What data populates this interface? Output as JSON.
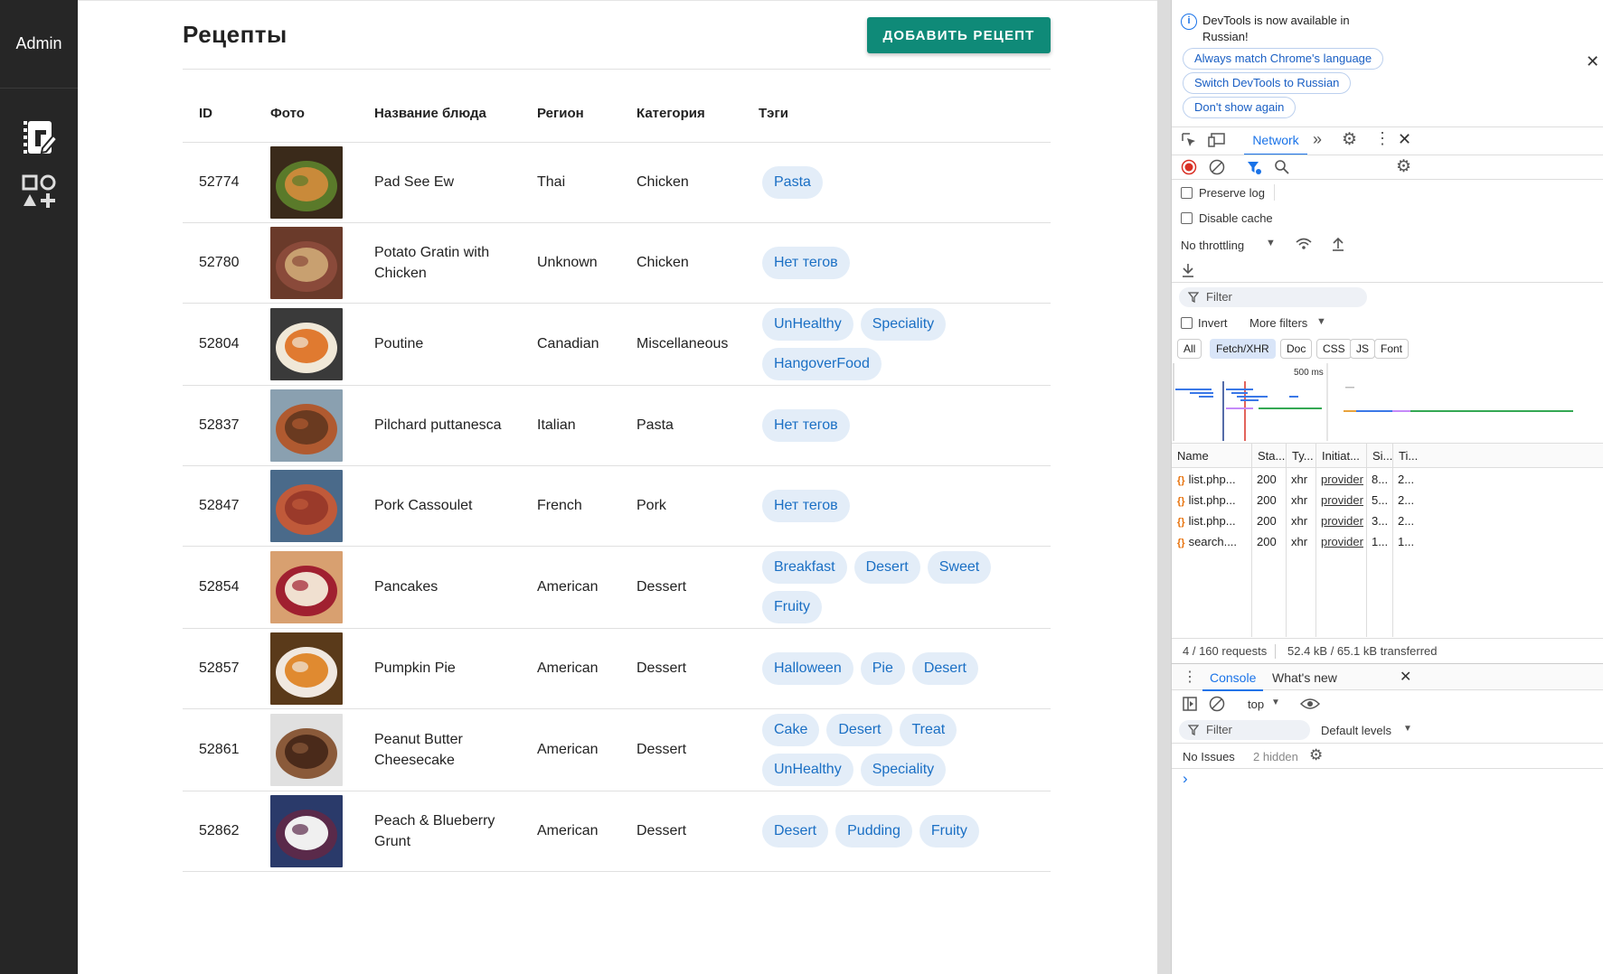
{
  "sidebar": {
    "title": "Admin",
    "items": [
      {
        "icon": "recipe-book-edit-icon"
      },
      {
        "icon": "shapes-add-icon"
      }
    ]
  },
  "header": {
    "title": "Рецепты",
    "add_button": "ДОБАВИТЬ РЕЦЕПТ"
  },
  "table": {
    "columns": [
      "ID",
      "Фото",
      "Название блюда",
      "Регион",
      "Категория",
      "Тэги"
    ],
    "rows": [
      {
        "id": "52774",
        "name": "Pad See Ew",
        "region": "Thai",
        "category": "Chicken",
        "tags": [
          "Pasta"
        ],
        "photo_colors": [
          "#3a2a1a",
          "#c98a3a",
          "#5a7a2a"
        ]
      },
      {
        "id": "52780",
        "name": "Potato Gratin with Chicken",
        "region": "Unknown",
        "category": "Chicken",
        "tags": [
          "Нет тегов"
        ],
        "photo_colors": [
          "#6a3a2a",
          "#c8a070",
          "#8a4a3a"
        ]
      },
      {
        "id": "52804",
        "name": "Poutine",
        "region": "Canadian",
        "category": "Miscellaneous",
        "tags": [
          "UnHealthy",
          "Speciality",
          "HangoverFood"
        ],
        "photo_colors": [
          "#3a3a3a",
          "#e07a30",
          "#f0e8d8"
        ]
      },
      {
        "id": "52837",
        "name": "Pilchard puttanesca",
        "region": "Italian",
        "category": "Pasta",
        "tags": [
          "Нет тегов"
        ],
        "photo_colors": [
          "#8aa0b0",
          "#6a3a20",
          "#b05a30"
        ]
      },
      {
        "id": "52847",
        "name": "Pork Cassoulet",
        "region": "French",
        "category": "Pork",
        "tags": [
          "Нет тегов"
        ],
        "photo_colors": [
          "#4a6a8a",
          "#9a3a2a",
          "#c05a3a"
        ]
      },
      {
        "id": "52854",
        "name": "Pancakes",
        "region": "American",
        "category": "Dessert",
        "tags": [
          "Breakfast",
          "Desert",
          "Sweet",
          "Fruity"
        ],
        "photo_colors": [
          "#d8a070",
          "#f0e0d0",
          "#a02030"
        ]
      },
      {
        "id": "52857",
        "name": "Pumpkin Pie",
        "region": "American",
        "category": "Dessert",
        "tags": [
          "Halloween",
          "Pie",
          "Desert"
        ],
        "photo_colors": [
          "#5a3a1a",
          "#e08a30",
          "#f0e8e0"
        ]
      },
      {
        "id": "52861",
        "name": "Peanut Butter Cheesecake",
        "region": "American",
        "category": "Dessert",
        "tags": [
          "Cake",
          "Desert",
          "Treat",
          "UnHealthy",
          "Speciality"
        ],
        "photo_colors": [
          "#e0e0e0",
          "#4a2a1a",
          "#8a5a3a"
        ]
      },
      {
        "id": "52862",
        "name": "Peach & Blueberry Grunt",
        "region": "American",
        "category": "Dessert",
        "tags": [
          "Desert",
          "Pudding",
          "Fruity"
        ],
        "photo_colors": [
          "#2a3a6a",
          "#f0f0f0",
          "#5a2a4a"
        ]
      }
    ]
  },
  "devtools": {
    "notice": {
      "text": "DevTools is now available in Russian!",
      "buttons": [
        "Always match Chrome's language",
        "Switch DevTools to Russian",
        "Don't show again"
      ]
    },
    "tabs": {
      "active": "Network"
    },
    "options": {
      "preserve_log": "Preserve log",
      "disable_cache": "Disable cache",
      "throttling": "No throttling",
      "filter_placeholder": "Filter",
      "invert": "Invert",
      "more_filters": "More filters"
    },
    "type_filters": [
      "All",
      "Fetch/XHR",
      "Doc",
      "CSS",
      "JS",
      "Font"
    ],
    "active_type_filter": "Fetch/XHR",
    "timeline_label": "500 ms",
    "request_columns": [
      "Name",
      "Sta...",
      "Ty...",
      "Initiat...",
      "Si...",
      "Ti..."
    ],
    "requests": [
      {
        "name": "list.php...",
        "status": "200",
        "type": "xhr",
        "initiator": "provider",
        "size": "8...",
        "time": "2..."
      },
      {
        "name": "list.php...",
        "status": "200",
        "type": "xhr",
        "initiator": "provider",
        "size": "5...",
        "time": "2..."
      },
      {
        "name": "list.php...",
        "status": "200",
        "type": "xhr",
        "initiator": "provider",
        "size": "3...",
        "time": "2..."
      },
      {
        "name": "search....",
        "status": "200",
        "type": "xhr",
        "initiator": "provider",
        "size": "1...",
        "time": "1..."
      }
    ],
    "summary": {
      "requests": "4 / 160 requests",
      "transfer": "52.4 kB / 65.1 kB transferred"
    },
    "drawer": {
      "tabs": [
        "Console",
        "What's new"
      ],
      "context": "top",
      "filter_placeholder": "Filter",
      "levels": "Default levels",
      "issues": "No Issues",
      "hidden": "2 hidden",
      "prompt": "›"
    }
  }
}
